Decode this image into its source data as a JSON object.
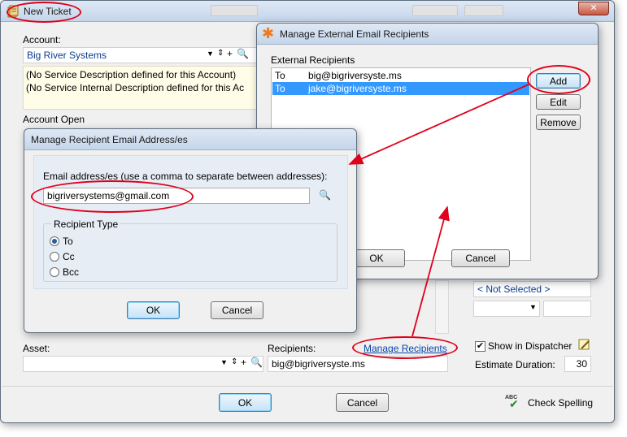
{
  "new_ticket": {
    "title": "New Ticket",
    "account_label": "Account:",
    "account_value": "Big River Systems",
    "service_desc_1": "(No Service Description defined for this Account)",
    "service_desc_2": "(No Service Internal Description defined for this Ac",
    "account_open_label": "Account Open",
    "asset_label": "Asset:",
    "recipients_label": "Recipients:",
    "recipients_value": "big@bigriversyste.ms",
    "manage_recipients_link": "Manage Recipients",
    "ok_label": "OK",
    "cancel_label": "Cancel",
    "check_spelling_label": "Check Spelling",
    "spell_badge": "ABC",
    "not_selected_value": "< Not Selected >",
    "show_in_dispatcher_label": "Show in Dispatcher",
    "show_in_dispatcher_checked": true,
    "estimate_duration_label": "Estimate Duration:",
    "estimate_duration_value": "30"
  },
  "external_dialog": {
    "title": "Manage External Email Recipients",
    "list_label": "External Recipients",
    "recipients": [
      {
        "type": "To",
        "email": "big@bigriversyste.ms",
        "selected": false
      },
      {
        "type": "To",
        "email": "jake@bigriversyste.ms",
        "selected": true
      }
    ],
    "add_label": "Add",
    "edit_label": "Edit",
    "remove_label": "Remove",
    "ok_label": "OK",
    "cancel_label": "Cancel"
  },
  "email_dialog": {
    "title": "Manage Recipient Email Address/es",
    "email_label": "Email address/es (use a comma to separate between addresses):",
    "email_value": "bigriversystems@gmail.com",
    "recipient_type_label": "Recipient Type",
    "options": [
      "To",
      "Cc",
      "Bcc"
    ],
    "selected_option": "To",
    "ok_label": "OK",
    "cancel_label": "Cancel"
  },
  "annotation_color": "#e0001b"
}
